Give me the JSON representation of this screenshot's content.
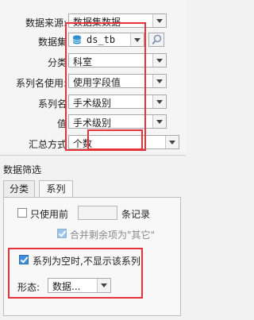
{
  "fields": {
    "source": {
      "label": "数据来源:",
      "value": "数据集数据"
    },
    "dataset": {
      "label": "数据集",
      "value": "ds_tb"
    },
    "category": {
      "label": "分类",
      "value": "科室"
    },
    "series_name_use": {
      "label": "系列名使用:",
      "value": "使用字段值"
    },
    "series_name": {
      "label": "系列名",
      "value": "手术级别"
    },
    "value": {
      "label": "值",
      "value": "手术级别"
    },
    "aggregate": {
      "label": "汇总方式",
      "value": "个数"
    }
  },
  "filter": {
    "title": "数据筛选",
    "tabs": [
      {
        "label": "分类"
      },
      {
        "label": "系列"
      }
    ],
    "only_use_first": {
      "label": "只使用前",
      "suffix": "条记录",
      "checked": false
    },
    "merge_rest": {
      "label": "合并剩余项为\"其它\"",
      "checked": true
    },
    "hide_null_series": {
      "label": "系列为空时,不显示该系列",
      "checked": true
    },
    "form": {
      "label": "形态:",
      "value": "数据..."
    }
  },
  "colors": {
    "highlight": "#e8323a",
    "accent": "#3b8de0"
  }
}
